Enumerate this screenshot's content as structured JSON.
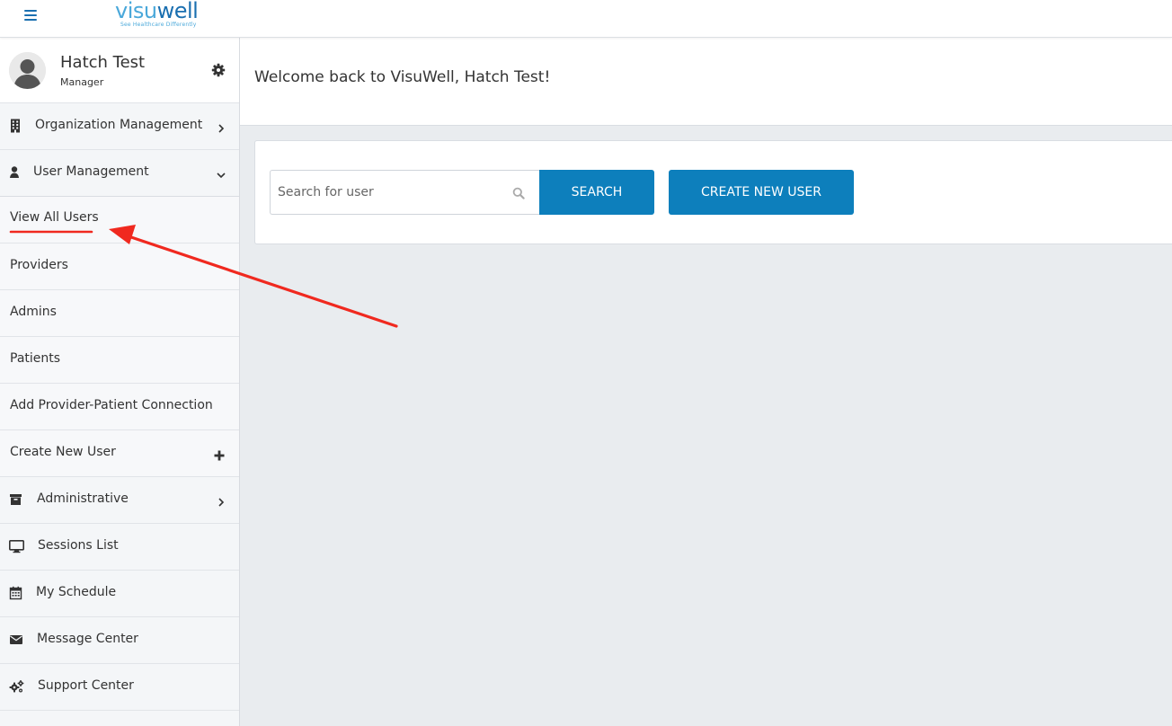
{
  "header": {
    "menu_icon": "hamburger-menu-icon",
    "logo": {
      "word_part1": "visu",
      "word_part2": "well",
      "tagline": "See Healthcare Differently"
    },
    "colors": {
      "logo_light": "#4aa8da",
      "logo_dark": "#1a6fb0"
    }
  },
  "profile": {
    "name": "Hatch Test",
    "role": "Manager",
    "avatar_icon": "user-avatar-icon",
    "settings_icon": "gear-icon"
  },
  "sidebar": {
    "organization_management": {
      "label": "Organization Management",
      "icon": "building-icon",
      "chevron": "chevron-right-icon"
    },
    "user_management": {
      "label": "User Management",
      "icon": "user-icon",
      "chevron": "chevron-down-icon"
    },
    "user_sub_items": [
      {
        "label": "View All Users"
      },
      {
        "label": "Providers"
      },
      {
        "label": "Admins"
      },
      {
        "label": "Patients"
      },
      {
        "label": "Add Provider-Patient Connection"
      },
      {
        "label": "Create New User",
        "icon": "plus-icon"
      }
    ],
    "administrative": {
      "label": "Administrative",
      "icon": "archive-icon",
      "chevron": "chevron-right-icon"
    },
    "sessions_list": {
      "label": "Sessions List",
      "icon": "monitor-icon"
    },
    "my_schedule": {
      "label": "My Schedule",
      "icon": "calendar-icon"
    },
    "message_center": {
      "label": "Message Center",
      "icon": "envelope-icon"
    },
    "support_center": {
      "label": "Support Center",
      "icon": "cogs-icon"
    }
  },
  "main": {
    "welcome": "Welcome back to VisuWell, Hatch Test!",
    "search": {
      "placeholder": "Search for user",
      "value": "",
      "icon": "search-icon"
    },
    "search_button": "SEARCH",
    "create_button": "CREATE NEW USER"
  },
  "colors": {
    "accent": "#0d7fbc",
    "annotation": "#f0291f"
  }
}
